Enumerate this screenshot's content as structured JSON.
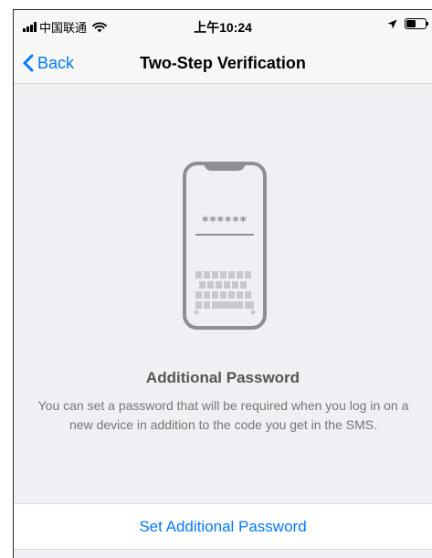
{
  "status_bar": {
    "carrier": "中国联通",
    "time": "上午10:24",
    "battery_level": 0.5
  },
  "nav": {
    "back_label": "Back",
    "title": "Two-Step Verification"
  },
  "illustration": {
    "password_mask": "******"
  },
  "content": {
    "heading": "Additional Password",
    "description": "You can set a password that will be required when you log in on a new device in addition to the code you get in the SMS."
  },
  "action": {
    "label": "Set Additional Password"
  },
  "colors": {
    "accent": "#007aff",
    "background": "#efeff4",
    "illustration": "#8e8e93"
  },
  "icons": [
    "signal-icon",
    "wifi-icon",
    "location-arrow-icon",
    "battery-icon",
    "chevron-left-icon",
    "phone-illustration"
  ]
}
